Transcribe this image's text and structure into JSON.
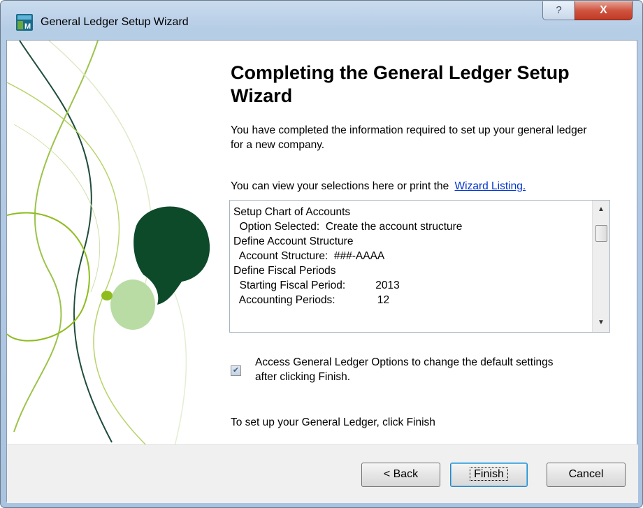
{
  "window": {
    "title": "General Ledger Setup Wizard",
    "help_glyph": "?",
    "close_glyph": "X"
  },
  "content": {
    "heading": "Completing the General Ledger Setup Wizard",
    "intro": "You have completed the information required to set up your general ledger for a new company.",
    "view_prefix": "You can view your selections here or print the",
    "view_link": "Wizard Listing.",
    "listing_lines": [
      "Setup Chart of Accounts",
      "  Option Selected:  Create the account structure",
      "Define Account Structure",
      "  Account Structure:  ###-AAAA",
      "Define Fiscal Periods",
      "  Starting Fiscal Period:          2013",
      "  Accounting Periods:              12"
    ],
    "checkbox_label": "Access General Ledger Options to change the default settings after clicking Finish.",
    "checkbox_checked": true,
    "footer": "To set up your General Ledger, click Finish"
  },
  "buttons": {
    "back": "< Back",
    "finish": "Finish",
    "cancel": "Cancel"
  },
  "colors": {
    "link": "#0033cc",
    "dark_green": "#0d4a2a",
    "light_green": "#b9dca4",
    "lime": "#8fbc1e"
  }
}
